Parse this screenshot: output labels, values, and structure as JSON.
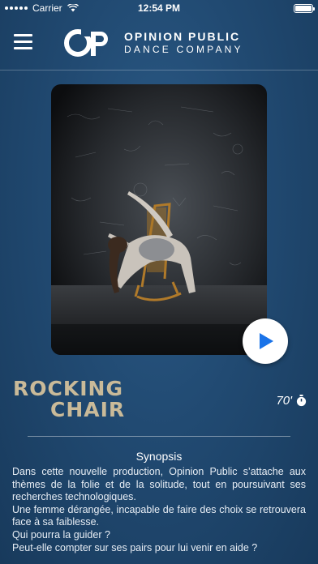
{
  "status_bar": {
    "carrier": "Carrier",
    "time": "12:54 PM",
    "battery_level": 1.0
  },
  "header": {
    "brand_line1": "OPINION PUBLIC",
    "brand_line2": "DANCE COMPANY",
    "menu_icon": "hamburger-menu-icon",
    "logo_icon": "opinion-public-logo"
  },
  "show": {
    "title_line1": "ROCKING",
    "title_line2": "CHAIR",
    "duration": "70'",
    "duration_icon": "stopwatch-icon",
    "play_icon": "play-icon",
    "accent_color": "#1a73e8",
    "title_color": "#c9ba99"
  },
  "synopsis": {
    "heading": "Synopsis",
    "paragraph1": "Dans cette nouvelle production, Opinion Public s’attache aux thèmes de la folie et de la solitude, tout en poursuivant ses recherches technologiques.",
    "paragraph2": "Une femme dérangée, incapable de faire des choix se retrouvera face à sa faiblesse.",
    "paragraph3": "Qui pourra la guider ?",
    "paragraph4": "Peut-elle compter sur ses pairs pour lui venir en aide ?"
  }
}
